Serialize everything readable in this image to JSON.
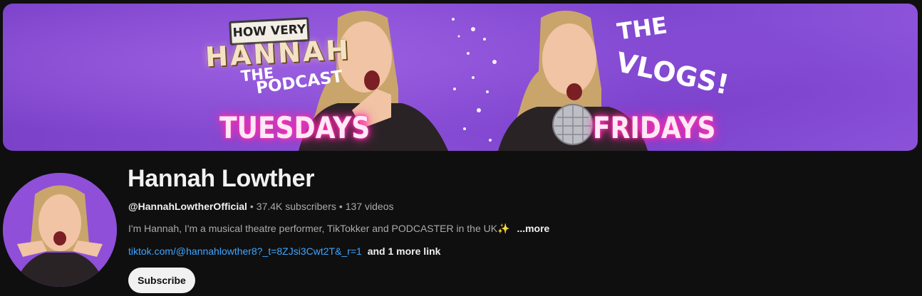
{
  "banner": {
    "podcast_sign_top": "HOW VERY",
    "podcast_sign_name": "HANNAH",
    "podcast_the": "THE",
    "podcast_label": "PODCAST",
    "day_left": "TUESDAYS",
    "vlogs_the": "THE",
    "vlogs_label": "VLOGS!",
    "day_right": "FRIDAYS"
  },
  "channel": {
    "name": "Hannah Lowther",
    "handle": "@HannahLowtherOfficial",
    "subscribers": "37.4K subscribers",
    "videos": "137 videos",
    "separator": "•",
    "description": "I'm Hannah, I'm a musical theatre performer, TikTokker and PODCASTER in the UK",
    "description_emoji": "✨",
    "more_label": "...more",
    "link_text": "tiktok.com/@hannahlowther8?_t=8ZJsi3Cwt2T&_r=1",
    "more_links": "and 1 more link"
  },
  "actions": {
    "subscribe_label": "Subscribe"
  },
  "colors": {
    "banner_purple": "#8a4fd6",
    "link_blue": "#3ea6ff",
    "page_bg": "#0f0f0f",
    "neon_pink": "#ff2aa8"
  }
}
